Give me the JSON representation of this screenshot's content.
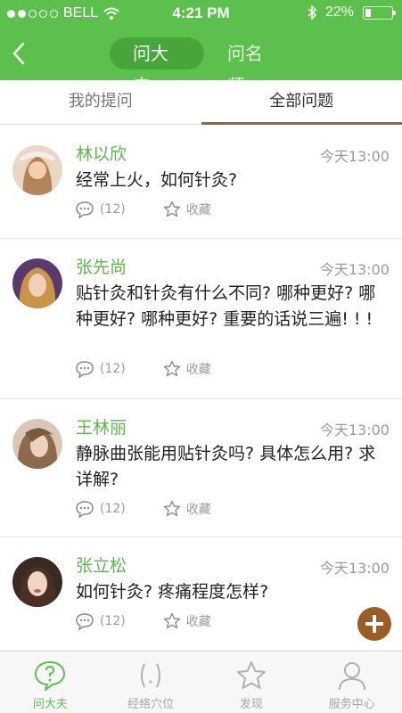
{
  "status": {
    "carrier": "BELL",
    "time": "4:21 PM",
    "battery": "22%",
    "battery_fraction": 0.22
  },
  "nav": {
    "segments": [
      {
        "label": "问大夫",
        "active": true
      },
      {
        "label": "问名师",
        "active": false
      }
    ]
  },
  "tabs": [
    {
      "label": "我的提问",
      "active": false
    },
    {
      "label": "全部问题",
      "active": true
    }
  ],
  "questions": [
    {
      "name": "林以欣",
      "time": "今天13:00",
      "text": "经常上火，如何针灸?",
      "comments": "(12)",
      "fav_label": "收藏"
    },
    {
      "name": "张先尚",
      "time": "今天13:00",
      "text": "贴针灸和针灸有什么不同? 哪种更好? 哪种更好? 哪种更好? 重要的话说三遍! ! !",
      "comments": "(12)",
      "fav_label": "收藏"
    },
    {
      "name": "王林丽",
      "time": "今天13:00",
      "text": "静脉曲张能用贴针灸吗? 具体怎么用? 求详解?",
      "comments": "(12)",
      "fav_label": "收藏"
    },
    {
      "name": "张立松",
      "time": "今天13:00",
      "text": "如何针灸? 疼痛程度怎样?",
      "comments": "(12)",
      "fav_label": "收藏"
    }
  ],
  "bottom_tabs": [
    {
      "label": "问大夫",
      "icon": "question-bubble-icon",
      "active": true
    },
    {
      "label": "经络穴位",
      "icon": "meridian-icon",
      "active": false
    },
    {
      "label": "发现",
      "icon": "star-icon",
      "active": false
    },
    {
      "label": "服务中心",
      "icon": "user-icon",
      "active": false
    }
  ],
  "colors": {
    "brand_green": "#5cc04c",
    "segment_active": "#47a63a",
    "accent_brown": "#9a5d25",
    "name_green": "#5cb54c"
  }
}
